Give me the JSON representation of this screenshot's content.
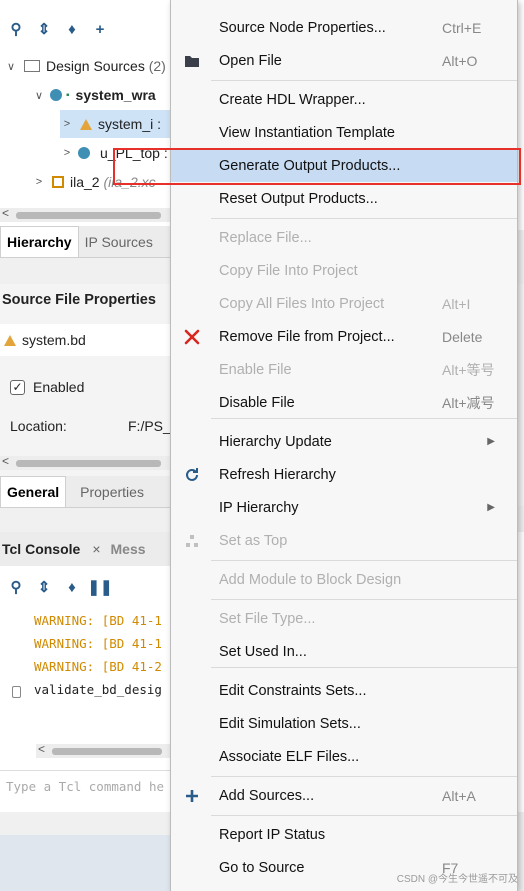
{
  "hierarchy": {
    "tree": {
      "design_sources": "Design Sources",
      "design_sources_count": "(2)",
      "wrapper": "system_wra",
      "system_i": "system_i :",
      "pl_top": "u_PL_top :",
      "ila": "ila_2",
      "ila_detail": "(ila_2.xc"
    },
    "tabs": [
      "Hierarchy",
      "IP Sources"
    ]
  },
  "source_file_properties": {
    "title": "Source File Properties",
    "file": "system.bd",
    "enabled_label": "Enabled",
    "location_label": "Location:",
    "location_value": "F:/PS_",
    "tabs": [
      "General",
      "Properties"
    ]
  },
  "tcl_console": {
    "tabs": [
      "Tcl Console",
      "Mess"
    ],
    "close_glyph": "×",
    "lines": [
      {
        "text": "WARNING: [BD 41-1",
        "kind": "warn"
      },
      {
        "text": "WARNING: [BD 41-1",
        "kind": "warn"
      },
      {
        "text": "WARNING: [BD 41-2",
        "kind": "warn"
      },
      {
        "text": "validate_bd_desig",
        "kind": "normal"
      }
    ],
    "command_placeholder": "Type a Tcl command he"
  },
  "context_menu": {
    "items": [
      {
        "label": "Source Node Properties...",
        "shortcut": "Ctrl+E",
        "icon": "",
        "enabled": true
      },
      {
        "label": "Open File",
        "shortcut": "Alt+O",
        "icon": "folder-icon",
        "enabled": true
      },
      {
        "label": "Create HDL Wrapper...",
        "shortcut": "",
        "icon": "",
        "enabled": true
      },
      {
        "label": "View Instantiation Template",
        "shortcut": "",
        "icon": "",
        "enabled": true
      },
      {
        "label": "Generate Output Products...",
        "shortcut": "",
        "icon": "",
        "enabled": true,
        "highlighted": true
      },
      {
        "label": "Reset Output Products...",
        "shortcut": "",
        "icon": "",
        "enabled": true
      },
      {
        "label": "Replace File...",
        "shortcut": "",
        "icon": "",
        "enabled": false
      },
      {
        "label": "Copy File Into Project",
        "shortcut": "",
        "icon": "",
        "enabled": false
      },
      {
        "label": "Copy All Files Into Project",
        "shortcut": "Alt+I",
        "icon": "",
        "enabled": false
      },
      {
        "label": "Remove File from Project...",
        "shortcut": "Delete",
        "icon": "red-x-icon",
        "enabled": true
      },
      {
        "label": "Enable File",
        "shortcut": "Alt+等号",
        "icon": "",
        "enabled": false
      },
      {
        "label": "Disable File",
        "shortcut": "Alt+减号",
        "icon": "",
        "enabled": true
      },
      {
        "label": "Hierarchy Update",
        "shortcut": "",
        "icon": "",
        "enabled": true,
        "submenu": true
      },
      {
        "label": "Refresh Hierarchy",
        "shortcut": "",
        "icon": "refresh-icon",
        "enabled": true
      },
      {
        "label": "IP Hierarchy",
        "shortcut": "",
        "icon": "",
        "enabled": true,
        "submenu": true
      },
      {
        "label": "Set as Top",
        "shortcut": "",
        "icon": "hierarchy-icon",
        "enabled": false
      },
      {
        "label": "Add Module to Block Design",
        "shortcut": "",
        "icon": "",
        "enabled": false
      },
      {
        "label": "Set File Type...",
        "shortcut": "",
        "icon": "",
        "enabled": false
      },
      {
        "label": "Set Used In...",
        "shortcut": "",
        "icon": "",
        "enabled": true
      },
      {
        "label": "Edit Constraints Sets...",
        "shortcut": "",
        "icon": "",
        "enabled": true
      },
      {
        "label": "Edit Simulation Sets...",
        "shortcut": "",
        "icon": "",
        "enabled": true
      },
      {
        "label": "Associate ELF Files...",
        "shortcut": "",
        "icon": "",
        "enabled": true
      },
      {
        "label": "Add Sources...",
        "shortcut": "Alt+A",
        "icon": "plus-icon",
        "enabled": true
      },
      {
        "label": "Report IP Status",
        "shortcut": "",
        "icon": "",
        "enabled": true
      },
      {
        "label": "Go to Source",
        "shortcut": "F7",
        "icon": "",
        "enabled": true
      }
    ],
    "submenu_glyph": "▶"
  },
  "watermark": "CSDN @今生今世遥不可及",
  "colors": {
    "highlight": "#c7dcf3",
    "annotation_box": "#e8302a",
    "warning_text": "#d08a00",
    "accent_icon": "#2a5c8a"
  }
}
